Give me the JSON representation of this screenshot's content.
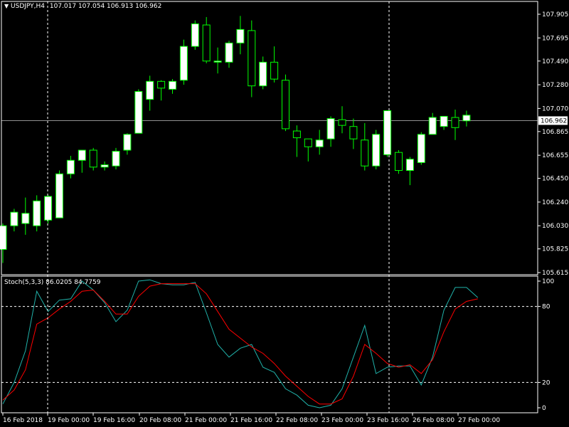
{
  "window": {
    "title": "USDJPY,H4",
    "ohlc": "107.017 107.054 106.913 106.962"
  },
  "colors": {
    "background": "#000000",
    "axis": "#ffffff",
    "bull_candle": "#ffffff",
    "candle_outline": "#00ff00",
    "stoch_main": "#20b2aa",
    "stoch_signal": "#ff0000",
    "grid_dash": "#ffffff"
  },
  "chart_data": [
    {
      "type": "candlestick",
      "symbol": "USDJPY",
      "timeframe": "H4",
      "ylim": [
        105.615,
        107.905
      ],
      "y_ticks": [
        "107.905",
        "107.695",
        "107.490",
        "107.280",
        "107.070",
        "106.865",
        "106.655",
        "106.450",
        "106.240",
        "106.030",
        "105.825",
        "105.615"
      ],
      "current_price": "106.962",
      "candles": [
        {
          "o": 105.82,
          "h": 106.05,
          "l": 105.7,
          "c": 106.03
        },
        {
          "o": 106.03,
          "h": 106.18,
          "l": 105.98,
          "c": 106.15
        },
        {
          "o": 106.05,
          "h": 106.28,
          "l": 105.95,
          "c": 106.14
        },
        {
          "o": 106.03,
          "h": 106.3,
          "l": 105.98,
          "c": 106.25
        },
        {
          "o": 106.08,
          "h": 106.3,
          "l": 106.05,
          "c": 106.29
        },
        {
          "o": 106.1,
          "h": 106.52,
          "l": 106.1,
          "c": 106.49
        },
        {
          "o": 106.49,
          "h": 106.65,
          "l": 106.45,
          "c": 106.61
        },
        {
          "o": 106.61,
          "h": 106.7,
          "l": 106.5,
          "c": 106.7
        },
        {
          "o": 106.7,
          "h": 106.72,
          "l": 106.52,
          "c": 106.55
        },
        {
          "o": 106.55,
          "h": 106.6,
          "l": 106.52,
          "c": 106.57
        },
        {
          "o": 106.56,
          "h": 106.72,
          "l": 106.53,
          "c": 106.69
        },
        {
          "o": 106.7,
          "h": 106.85,
          "l": 106.66,
          "c": 106.84
        },
        {
          "o": 106.85,
          "h": 107.24,
          "l": 106.85,
          "c": 107.22
        },
        {
          "o": 107.15,
          "h": 107.36,
          "l": 107.05,
          "c": 107.31
        },
        {
          "o": 107.31,
          "h": 107.32,
          "l": 107.14,
          "c": 107.25
        },
        {
          "o": 107.24,
          "h": 107.33,
          "l": 107.2,
          "c": 107.31
        },
        {
          "o": 107.32,
          "h": 107.68,
          "l": 107.28,
          "c": 107.62
        },
        {
          "o": 107.62,
          "h": 107.85,
          "l": 107.59,
          "c": 107.82
        },
        {
          "o": 107.81,
          "h": 107.88,
          "l": 107.47,
          "c": 107.49
        },
        {
          "o": 107.48,
          "h": 107.61,
          "l": 107.38,
          "c": 107.49
        },
        {
          "o": 107.48,
          "h": 107.67,
          "l": 107.43,
          "c": 107.65
        },
        {
          "o": 107.65,
          "h": 107.89,
          "l": 107.55,
          "c": 107.77
        },
        {
          "o": 107.76,
          "h": 107.85,
          "l": 107.17,
          "c": 107.27
        },
        {
          "o": 107.27,
          "h": 107.53,
          "l": 107.24,
          "c": 107.48
        },
        {
          "o": 107.48,
          "h": 107.62,
          "l": 107.3,
          "c": 107.33
        },
        {
          "o": 107.32,
          "h": 107.37,
          "l": 106.87,
          "c": 106.89
        },
        {
          "o": 106.87,
          "h": 106.92,
          "l": 106.64,
          "c": 106.81
        },
        {
          "o": 106.8,
          "h": 106.79,
          "l": 106.6,
          "c": 106.73
        },
        {
          "o": 106.73,
          "h": 106.88,
          "l": 106.66,
          "c": 106.79
        },
        {
          "o": 106.8,
          "h": 107.0,
          "l": 106.73,
          "c": 106.98
        },
        {
          "o": 106.97,
          "h": 107.09,
          "l": 106.85,
          "c": 106.92
        },
        {
          "o": 106.91,
          "h": 106.98,
          "l": 106.71,
          "c": 106.8
        },
        {
          "o": 106.79,
          "h": 106.94,
          "l": 106.52,
          "c": 106.56
        },
        {
          "o": 106.56,
          "h": 106.88,
          "l": 106.53,
          "c": 106.84
        },
        {
          "o": 106.66,
          "h": 107.05,
          "l": 106.64,
          "c": 107.05
        },
        {
          "o": 106.68,
          "h": 106.7,
          "l": 106.49,
          "c": 106.52
        },
        {
          "o": 106.52,
          "h": 106.64,
          "l": 106.39,
          "c": 106.62
        },
        {
          "o": 106.59,
          "h": 106.86,
          "l": 106.57,
          "c": 106.84
        },
        {
          "o": 106.84,
          "h": 107.03,
          "l": 106.84,
          "c": 106.99
        },
        {
          "o": 106.91,
          "h": 107.0,
          "l": 106.88,
          "c": 107.0
        },
        {
          "o": 106.99,
          "h": 107.06,
          "l": 106.79,
          "c": 106.9
        },
        {
          "o": 106.96,
          "h": 107.05,
          "l": 106.91,
          "c": 107.01
        }
      ]
    },
    {
      "type": "line",
      "title": "Stoch(5,3,3) 86.0205 84.7759",
      "ylim": [
        0,
        100
      ],
      "y_ticks": [
        "100",
        "80",
        "20",
        "0"
      ],
      "levels": [
        80,
        20
      ],
      "x_labels": [
        "16 Feb 2018",
        "19 Feb 00:00",
        "19 Feb 16:00",
        "20 Feb 08:00",
        "21 Feb 00:00",
        "21 Feb 16:00",
        "22 Feb 08:00",
        "23 Feb 00:00",
        "23 Feb 16:00",
        "26 Feb 08:00",
        "27 Feb 00:00"
      ],
      "series": [
        {
          "values": [
            3,
            20,
            45,
            92,
            76,
            85,
            86,
            100,
            93,
            83,
            68,
            77,
            100,
            101,
            98,
            97,
            97,
            99,
            75,
            50,
            40,
            47,
            50,
            32,
            28,
            15,
            10,
            2,
            0,
            2,
            15,
            40,
            65,
            27,
            32,
            33,
            33,
            18,
            40,
            77,
            95,
            95,
            87
          ]
        },
        {
          "values": [
            6,
            14,
            30,
            66,
            71,
            78,
            84,
            92,
            93,
            84,
            74,
            74,
            88,
            96,
            98,
            98,
            98,
            98,
            90,
            76,
            62,
            55,
            48,
            43,
            35,
            25,
            17,
            9,
            3,
            3,
            7,
            25,
            50,
            43,
            35,
            32,
            34,
            27,
            38,
            60,
            78,
            84,
            86
          ]
        }
      ]
    }
  ]
}
